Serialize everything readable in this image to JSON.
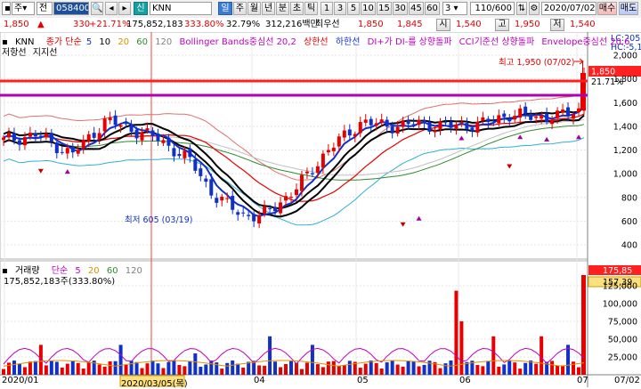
{
  "toolbar": {
    "market": "주",
    "market_arrow": "▾",
    "mode": "전",
    "code": "058400",
    "code_badge": "▾",
    "btn_credit": "신",
    "stock_name": "KNN",
    "period_buttons": [
      "일",
      "주",
      "월",
      "년",
      "분",
      "초",
      "틱"
    ],
    "numbers": [
      "1",
      "3",
      "5",
      "10",
      "15",
      "30",
      "45",
      "60"
    ],
    "count_select": "3",
    "range": "110/600",
    "date": "2020/07/02",
    "buy": "매수",
    "sell": "매도"
  },
  "info": {
    "price": "1,850",
    "change_arrow": "▲",
    "change": "330",
    "change_pct": "+21.71%",
    "volume": "175,852,183",
    "vol_pct": "333.80%",
    "turnover": "32.79%",
    "amount": "312,216백만",
    "best_ask_label": "최우선",
    "best_ask": "1,850",
    "best_bid": "1,845",
    "open_label": "시",
    "open": "1,540",
    "high_label": "고",
    "high": "1,950",
    "low_label": "저",
    "low": "1,540"
  },
  "legend_main": {
    "name": "KNN",
    "ma": "종가 단순",
    "ma5": "5",
    "ma10": "10",
    "ma20": "20",
    "ma60": "60",
    "ma120": "120",
    "bollinger": "Bollinger Bands중심선 20,2",
    "upper": "상한선",
    "lower": "하한선",
    "dmi": "DI+가 DI-를 상향돌파",
    "cci": "CCI기준선 상향돌파",
    "envelope": "Envelope중심선 20,6",
    "line2a": "저항선",
    "line2b": "지지선"
  },
  "legend_vol": {
    "name": "거래량",
    "ma": "단순",
    "ma5": "5",
    "ma20": "20",
    "ma60": "60",
    "ma120": "120",
    "current": "175,852,183주(333.80%)"
  },
  "annotations": {
    "high": "최고 1,950 (07/02)",
    "low": "최저 605 (03/19)"
  },
  "price_axis": {
    "labels": [
      "2,000",
      "1,800",
      "1,600",
      "1,400",
      "1,200",
      "1,000",
      "800",
      "600",
      "400"
    ],
    "tag_price": "1,850",
    "tag_pct": "21.71%",
    "lc": "LC:205,",
    "hc": "HC:-5,1"
  },
  "volume_axis": {
    "labels": [
      "125,000",
      "100,000",
      "75,000",
      "50,000",
      "25,000"
    ],
    "tag_vol": "175,85",
    "tag_ma": "157,39"
  },
  "x_axis": {
    "labels": [
      "2020/01",
      "2020/03/05(목)",
      "04",
      "05",
      "06",
      "07",
      "07/02"
    ]
  },
  "colors": {
    "up": "#e60000",
    "down": "#1030c8",
    "ma5": "#1030c8",
    "ma10": "#000000",
    "ma20": "#e60000",
    "ma60": "#2e8b2e",
    "bollinger": "#e07070",
    "envelope": "#30b0d0",
    "hline_red": "#ff2020",
    "hline_purple": "#b000b0"
  }
}
